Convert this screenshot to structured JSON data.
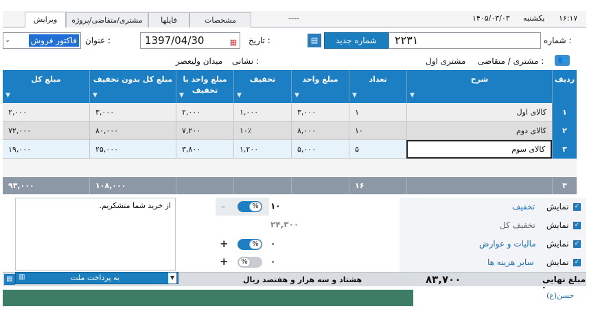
{
  "tabs": [
    {
      "label": "ویرایش"
    },
    {
      "label": "مشتری/متقاضی/پروژه"
    },
    {
      "label": "فایلها"
    },
    {
      "label": "مشخصات"
    }
  ],
  "topbar": {
    "dashes": "----",
    "date": "۱۴۰۵/۰۳/۰۳",
    "weekday": "یکشنبه",
    "time": "۱۶:۱۷"
  },
  "form": {
    "number_label": "شماره :",
    "number_value": "۲۲۳۱",
    "new_number_button": "شماره جدید",
    "date_label": "تاریخ :",
    "date_value": "1397/04/30",
    "title_label": "عنوان :",
    "title_value": "فاکتور فروش",
    "customer_label": "مشتری / متقاضی :",
    "customer_value": "مشتری اول",
    "address_label": "نشانی :",
    "address_value": "میدان ولیعصر"
  },
  "grid": {
    "columns": [
      "ردیف",
      "شرح",
      "تعداد",
      "مبلغ واحد",
      "تخفیف",
      "مبلغ واحد با تخفیف",
      "مبلغ کل بدون تخفیف",
      "مبلغ کل"
    ],
    "rows": [
      {
        "idx": "۱",
        "desc": "کالای اول",
        "qty": "۱",
        "unit": "۳,۰۰۰",
        "disc": "۱,۰۰۰",
        "unit_disc": "۲,۰۰۰",
        "total_nodisc": "۳,۰۰۰",
        "total": "۲,۰۰۰"
      },
      {
        "idx": "۲",
        "desc": "کالای دوم",
        "qty": "۱۰",
        "unit": "۸,۰۰۰",
        "disc": "۱۰٪",
        "unit_disc": "۷,۲۰۰",
        "total_nodisc": "۸۰,۰۰۰",
        "total": "۷۲,۰۰۰"
      },
      {
        "idx": "۳",
        "desc": "کالای سوم",
        "qty": "۵",
        "unit": "۵,۰۰۰",
        "disc": "۱,۲۰۰",
        "unit_disc": "۳,۸۰۰",
        "total_nodisc": "۲۵,۰۰۰",
        "total": "۱۹,۰۰۰"
      }
    ],
    "footer": {
      "count": "۳",
      "qty": "۱۶",
      "total_nodisc": "۱۰۸,۰۰۰",
      "total": "۹۳,۰۰۰"
    }
  },
  "memo": "از خرید شما متشکریم.",
  "adjust": {
    "discount_value": "۱۰",
    "subtotal": "۲۴,۳۰۰",
    "tax_value": "۰",
    "other_value": "۰",
    "percent": "%",
    "plus": "+",
    "minus": "-"
  },
  "options": [
    {
      "show": "نمایش",
      "label": "تخفیف"
    },
    {
      "show": "نمایش",
      "label": "تخفیف کل"
    },
    {
      "show": "نمایش",
      "label": "مالیات و عوارض"
    },
    {
      "show": "نمایش",
      "label": "سایر هزینه ها"
    }
  ],
  "status": {
    "final_label": "مبلغ نهایی :",
    "final_value": "۸۳,۷۰۰",
    "in_words": "هشتاد و سه هزار و هفتصد ریال",
    "payment": "به پرداخت ملت"
  },
  "footer_label": "حسن(ع)",
  "colors": {
    "accent": "#1c7fc4",
    "header": "#1c7fc4",
    "footer": "#8c98a6"
  }
}
